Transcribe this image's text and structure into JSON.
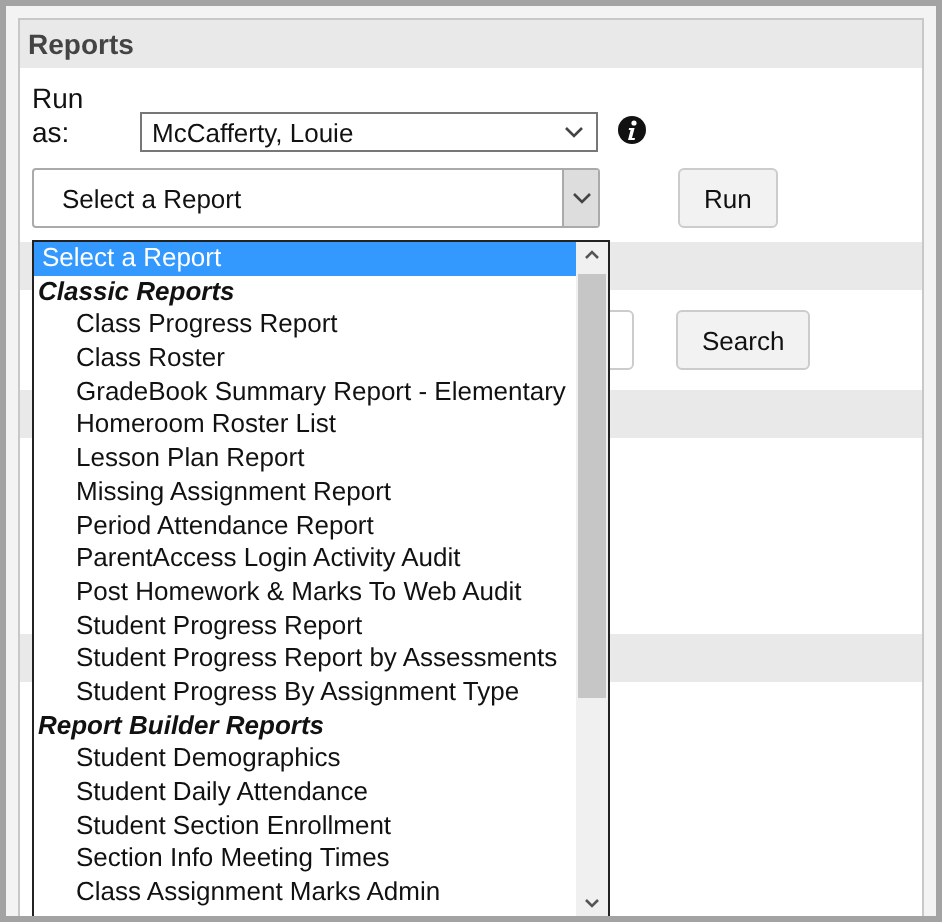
{
  "header": {
    "title": "Reports"
  },
  "run_as": {
    "label": "Run as:",
    "value": "McCafferty, Louie"
  },
  "report_select": {
    "value": "Select a Report",
    "expanded": true
  },
  "run_button": "Run",
  "search_button": "Search",
  "report_list": [
    {
      "kind": "option",
      "label": "Select a Report",
      "selected": true
    },
    {
      "kind": "group",
      "label": "Classic Reports"
    },
    {
      "kind": "option",
      "label": "Class Progress Report",
      "selected": false
    },
    {
      "kind": "option",
      "label": "Class Roster",
      "selected": false
    },
    {
      "kind": "option",
      "label": "GradeBook Summary Report - Elementary",
      "selected": false
    },
    {
      "kind": "option",
      "label": "Homeroom Roster List",
      "selected": false
    },
    {
      "kind": "option",
      "label": "Lesson Plan Report",
      "selected": false
    },
    {
      "kind": "option",
      "label": "Missing Assignment Report",
      "selected": false
    },
    {
      "kind": "option",
      "label": "Period Attendance Report",
      "selected": false
    },
    {
      "kind": "option",
      "label": "ParentAccess Login Activity Audit",
      "selected": false
    },
    {
      "kind": "option",
      "label": "Post Homework & Marks To Web Audit",
      "selected": false
    },
    {
      "kind": "option",
      "label": "Student Progress Report",
      "selected": false
    },
    {
      "kind": "option",
      "label": "Student Progress Report by Assessments",
      "selected": false
    },
    {
      "kind": "option",
      "label": "Student Progress By Assignment Type",
      "selected": false
    },
    {
      "kind": "group",
      "label": "Report Builder Reports"
    },
    {
      "kind": "option",
      "label": "Student Demographics",
      "selected": false
    },
    {
      "kind": "option",
      "label": "Student Daily Attendance",
      "selected": false
    },
    {
      "kind": "option",
      "label": "Student Section Enrollment",
      "selected": false
    },
    {
      "kind": "option",
      "label": "Section Info Meeting Times",
      "selected": false
    },
    {
      "kind": "option",
      "label": "Class Assignment Marks Admin",
      "selected": false
    }
  ]
}
